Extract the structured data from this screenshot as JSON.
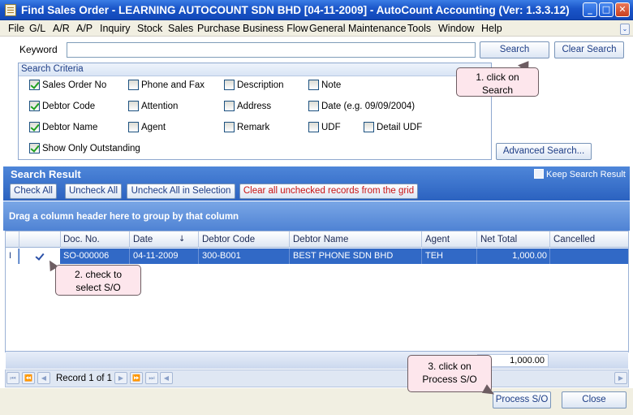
{
  "window": {
    "title": "Find Sales Order - LEARNING AUTOCOUNT SDN BHD [04-11-2009] - AutoCount Accounting (Ver: 1.3.3.12)"
  },
  "menu": [
    "File",
    "G/L",
    "A/R",
    "A/P",
    "Inquiry",
    "Stock",
    "Sales",
    "Purchase",
    "Business Flow",
    "General Maintenance",
    "Tools",
    "Window",
    "Help"
  ],
  "search": {
    "keyword_label": "Keyword",
    "keyword_value": "",
    "search_button": "Search",
    "clear_button": "Clear Search",
    "advanced_button": "Advanced Search..."
  },
  "criteria": {
    "title": "Search Criteria",
    "options": [
      {
        "label": "Sales Order No",
        "checked": true
      },
      {
        "label": "Phone and Fax",
        "checked": false
      },
      {
        "label": "Description",
        "checked": false
      },
      {
        "label": "Note",
        "checked": false
      },
      {
        "label": "Debtor Code",
        "checked": true
      },
      {
        "label": "Attention",
        "checked": false
      },
      {
        "label": "Address",
        "checked": false
      },
      {
        "label": "Date (e.g. 09/09/2004)",
        "checked": false
      },
      {
        "label": "Debtor Name",
        "checked": true
      },
      {
        "label": "Agent",
        "checked": false
      },
      {
        "label": "Remark",
        "checked": false
      },
      {
        "label": "UDF",
        "checked": false
      },
      {
        "label": "Detail UDF",
        "checked": false
      },
      {
        "label": "Show Only Outstanding",
        "checked": true
      }
    ]
  },
  "callouts": {
    "step1": [
      "1. click on",
      "Search"
    ],
    "step2": [
      "2. check to",
      "select S/O"
    ],
    "step3": [
      "3. click on",
      "Process S/O"
    ]
  },
  "result": {
    "title": "Search Result",
    "keep_label": "Keep Search Result",
    "keep_checked": false,
    "check_all": "Check All",
    "uncheck_all": "Uncheck All",
    "uncheck_selection": "Uncheck All in Selection",
    "clear_unchecked": "Clear all unchecked records from the grid",
    "group_hint": "Drag a column header here to group by that column"
  },
  "grid": {
    "columns": [
      "Doc. No.",
      "Date",
      "Debtor Code",
      "Debtor Name",
      "Agent",
      "Net Total",
      "Cancelled"
    ],
    "sort_indicator": "↓",
    "rows": [
      {
        "indicator": "I",
        "checked": true,
        "doc_no": "SO-000006",
        "date": "04-11-2009",
        "debtor_code": "300-B001",
        "debtor_name": "BEST PHONE SDN BHD",
        "agent": "TEH",
        "net_total": "1,000.00",
        "cancelled": ""
      }
    ],
    "footer_total": "1,000.00",
    "record_text": "Record 1 of 1"
  },
  "buttons": {
    "process": "Process S/O",
    "close": "Close"
  },
  "colors": {
    "title_bar": "#1a55c8",
    "result_header": "#2b62c0",
    "selected_row": "#3169c6",
    "callout_bg": "#fde6ec",
    "clear_unchecked_text": "#c81414"
  }
}
